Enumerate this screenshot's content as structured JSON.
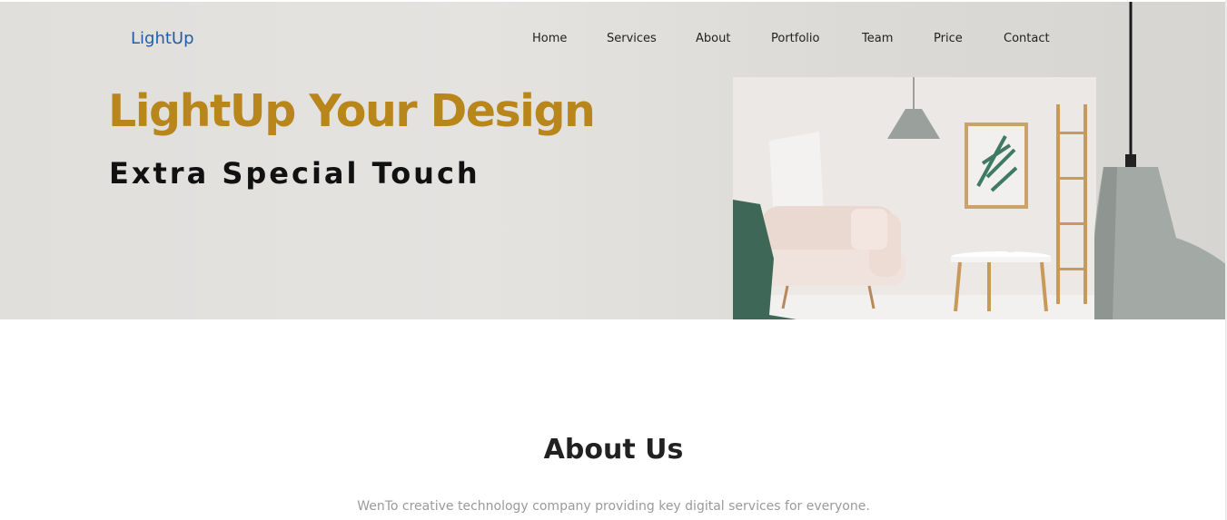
{
  "brand": {
    "logo": "LightUp"
  },
  "nav": {
    "items": [
      "Home",
      "Services",
      "About",
      "Portfolio",
      "Team",
      "Price",
      "Contact"
    ]
  },
  "hero": {
    "title": "LightUp Your Design",
    "subtitle": "Extra Special Touch",
    "images": [
      "room-interior-photo",
      "hanging-lamp-photo"
    ]
  },
  "about": {
    "title": "About Us",
    "text": "WenTo creative technology company providing key digital services for everyone."
  },
  "colors": {
    "accent": "#b8861b",
    "logo": "#1f5fa8",
    "hero_bg": "#e1dfdc"
  }
}
